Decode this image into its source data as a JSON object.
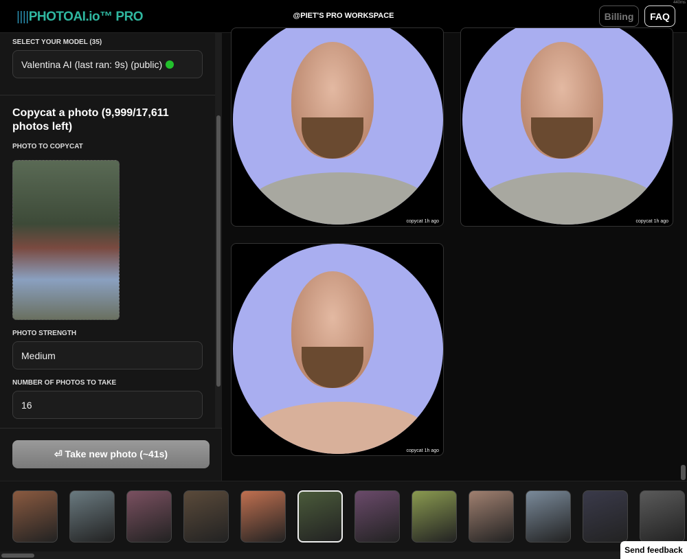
{
  "header": {
    "logo_bars": "||||",
    "logo_text": "PHOTOAI.io™ PRO",
    "workspace": "@PIET'S PRO WORKSPACE",
    "billing": "Billing",
    "faq": "FAQ",
    "latency": "440ms"
  },
  "sidebar": {
    "model_label": "SELECT YOUR MODEL (35)",
    "model_value": "Valentina AI (last ran: 9s) (public)",
    "status_color": "#22c02c",
    "section_title": "Copycat a photo (9,999/17,611 photos left)",
    "copy_label": "PHOTO TO COPYCAT",
    "strength_label": "PHOTO STRENGTH",
    "strength_value": "Medium",
    "count_label": "NUMBER OF PHOTOS TO TAKE",
    "count_value": "16",
    "take_button": "⏎ Take new photo (~41s)"
  },
  "gallery": [
    {
      "caption": "copycat 1h ago"
    },
    {
      "caption": "copycat 1h ago"
    },
    {
      "caption": "copycat 1h ago"
    }
  ],
  "strip": {
    "thumbnail_count": 12,
    "selected_index": 5
  },
  "feedback": "Send feedback"
}
